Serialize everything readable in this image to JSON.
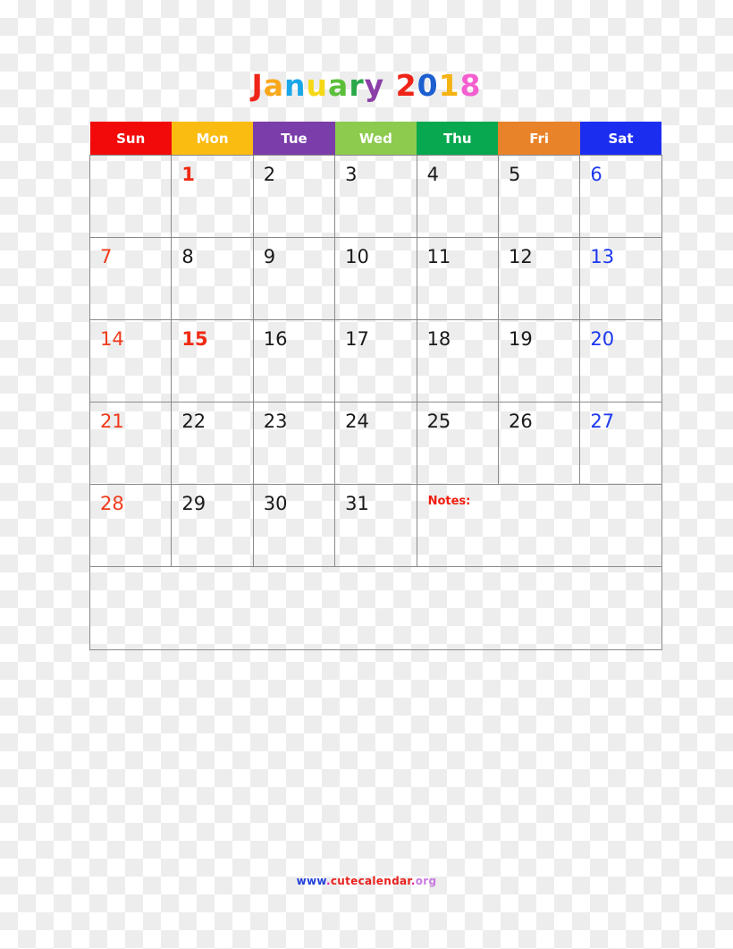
{
  "title": {
    "text": "January 2018",
    "month": "January",
    "year": "2018",
    "letters": [
      {
        "ch": "J",
        "color": "#ef2418"
      },
      {
        "ch": "a",
        "color": "#f9a81b"
      },
      {
        "ch": "n",
        "color": "#1aa7e8"
      },
      {
        "ch": "u",
        "color": "#f5d916"
      },
      {
        "ch": "a",
        "color": "#5cbf3a"
      },
      {
        "ch": "r",
        "color": "#2aa84a"
      },
      {
        "ch": "y",
        "color": "#8b3fa8"
      },
      {
        "ch": " ",
        "color": "#000000"
      },
      {
        "ch": "2",
        "color": "#ef2418"
      },
      {
        "ch": "0",
        "color": "#1c5fd0"
      },
      {
        "ch": "1",
        "color": "#f5b312"
      },
      {
        "ch": "8",
        "color": "#f45fd0"
      }
    ]
  },
  "weekdays": [
    {
      "label": "Sun",
      "bg": "#f20a0a"
    },
    {
      "label": "Mon",
      "bg": "#fbbc12"
    },
    {
      "label": "Tue",
      "bg": "#7a3daa"
    },
    {
      "label": "Wed",
      "bg": "#8dcb4e"
    },
    {
      "label": "Thu",
      "bg": "#07a84f"
    },
    {
      "label": "Fri",
      "bg": "#e8832a"
    },
    {
      "label": "Sat",
      "bg": "#1b2ef0"
    }
  ],
  "weeks": [
    [
      {
        "day": "",
        "kind": "empty"
      },
      {
        "day": "1",
        "kind": "holiday"
      },
      {
        "day": "2",
        "kind": "weekday"
      },
      {
        "day": "3",
        "kind": "weekday"
      },
      {
        "day": "4",
        "kind": "weekday"
      },
      {
        "day": "5",
        "kind": "weekday"
      },
      {
        "day": "6",
        "kind": "sat"
      }
    ],
    [
      {
        "day": "7",
        "kind": "sun"
      },
      {
        "day": "8",
        "kind": "weekday"
      },
      {
        "day": "9",
        "kind": "weekday"
      },
      {
        "day": "10",
        "kind": "weekday"
      },
      {
        "day": "11",
        "kind": "weekday"
      },
      {
        "day": "12",
        "kind": "weekday"
      },
      {
        "day": "13",
        "kind": "sat"
      }
    ],
    [
      {
        "day": "14",
        "kind": "sun"
      },
      {
        "day": "15",
        "kind": "holiday"
      },
      {
        "day": "16",
        "kind": "weekday"
      },
      {
        "day": "17",
        "kind": "weekday"
      },
      {
        "day": "18",
        "kind": "weekday"
      },
      {
        "day": "19",
        "kind": "weekday"
      },
      {
        "day": "20",
        "kind": "sat"
      }
    ],
    [
      {
        "day": "21",
        "kind": "sun"
      },
      {
        "day": "22",
        "kind": "weekday"
      },
      {
        "day": "23",
        "kind": "weekday"
      },
      {
        "day": "24",
        "kind": "weekday"
      },
      {
        "day": "25",
        "kind": "weekday"
      },
      {
        "day": "26",
        "kind": "weekday"
      },
      {
        "day": "27",
        "kind": "sat"
      }
    ],
    [
      {
        "day": "28",
        "kind": "sun"
      },
      {
        "day": "29",
        "kind": "weekday"
      },
      {
        "day": "30",
        "kind": "weekday"
      },
      {
        "day": "31",
        "kind": "weekday"
      }
    ]
  ],
  "notes": {
    "label": "Notes:",
    "color": "#f01e0f"
  },
  "footer": {
    "text": "www.cutecalendar.org",
    "segments": [
      {
        "text": "www",
        "color": "#2140d8"
      },
      {
        "text": ".",
        "color": "#e01ea8"
      },
      {
        "text": "cutecalendar",
        "color": "#e8201c"
      },
      {
        "text": ".",
        "color": "#e01ea8"
      },
      {
        "text": "org",
        "color": "#c87ae0"
      }
    ]
  }
}
